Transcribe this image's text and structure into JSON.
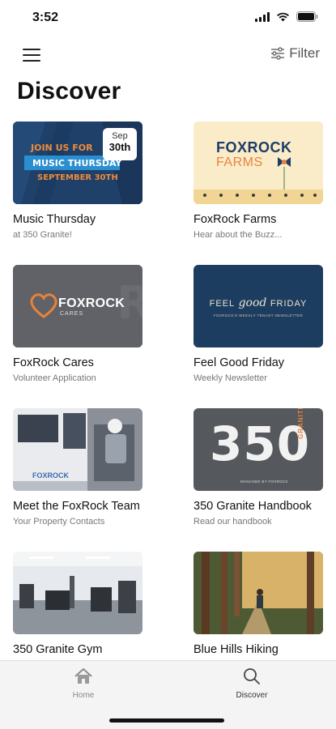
{
  "status": {
    "time": "3:52"
  },
  "header": {
    "filter_label": "Filter",
    "title": "Discover"
  },
  "cards": [
    {
      "title": "Music Thursday",
      "subtitle": "at 350 Granite!",
      "image": {
        "line1": "JOIN US FOR",
        "line2": "MUSIC THURSDAY",
        "line3": "SEPTEMBER 30TH",
        "badge_month": "Sep",
        "badge_day": "30th"
      }
    },
    {
      "title": "FoxRock Farms",
      "subtitle": "Hear about the Buzz...",
      "image": {
        "brand": "FOXROCK",
        "brand_sub": "FARMS"
      }
    },
    {
      "title": "FoxRock Cares",
      "subtitle": "Volunteer Application",
      "image": {
        "brand": "FOXROCK",
        "brand_sub": "CARES"
      }
    },
    {
      "title": "Feel Good Friday",
      "subtitle": "Weekly Newsletter",
      "image": {
        "line1": "FEEL",
        "line2": "good",
        "line3": "FRIDAY",
        "line4": "FOXROCK'S WEEKLY TENANT NEWSLETTER"
      }
    },
    {
      "title": "Meet the FoxRock Team",
      "subtitle": "Your Property Contacts",
      "image": {
        "van_text": "FOXROCK"
      }
    },
    {
      "title": "350 Granite Handbook",
      "subtitle": "Read our handbook",
      "image": {
        "number": "350",
        "side_word": "GRANITE",
        "footer": "MANAGED BY FOXROCK"
      }
    },
    {
      "title": "350 Granite Gym",
      "subtitle": "",
      "image": {}
    },
    {
      "title": "Blue Hills Hiking",
      "subtitle": "",
      "image": {}
    }
  ],
  "tabs": [
    {
      "label": "Home",
      "icon": "home-icon",
      "active": false
    },
    {
      "label": "Discover",
      "icon": "search-icon",
      "active": true
    }
  ],
  "colors": {
    "active_tab": "#333333",
    "inactive_tab": "#8a8a8a",
    "accent_orange": "#e8823a",
    "navy": "#1b3a5c"
  }
}
